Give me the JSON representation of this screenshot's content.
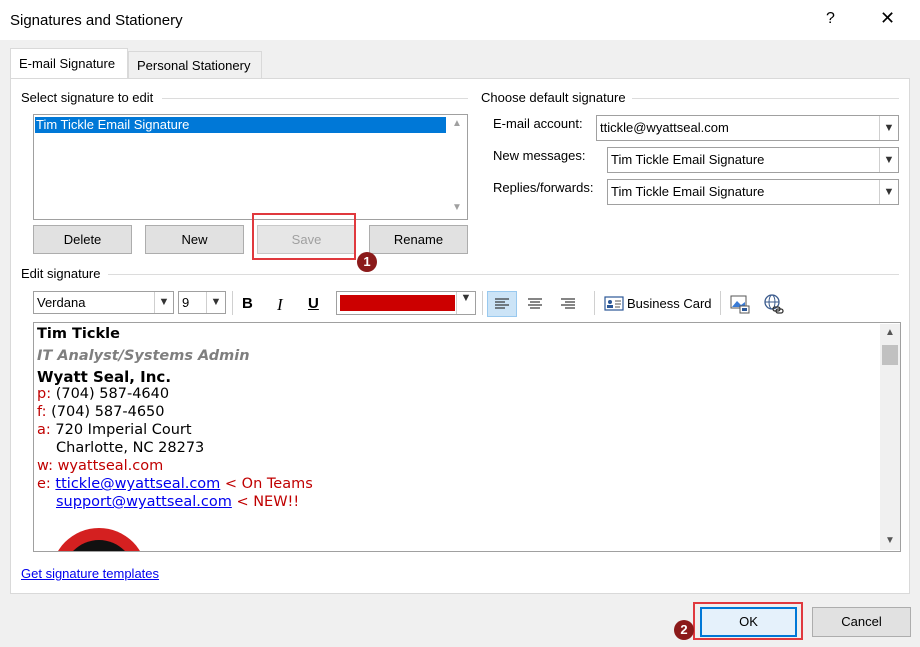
{
  "window": {
    "title": "Signatures and Stationery",
    "help_label": "?",
    "close_label": "✕"
  },
  "tabs": [
    {
      "label": "E-mail Signature",
      "active": true
    },
    {
      "label": "Personal Stationery",
      "active": false
    }
  ],
  "select_section": {
    "label": "Select signature to edit",
    "items": [
      "Tim Tickle Email Signature"
    ],
    "selected_index": 0
  },
  "buttons": {
    "delete": "Delete",
    "new": "New",
    "save": "Save",
    "rename": "Rename",
    "ok": "OK",
    "cancel": "Cancel"
  },
  "badges": {
    "one": "1",
    "two": "2"
  },
  "default_section": {
    "label": "Choose default signature",
    "account_label": "E-mail account:",
    "account_value": "ttickle@wyattseal.com",
    "new_messages_label": "New messages:",
    "new_messages_value": "Tim Tickle Email Signature",
    "replies_label": "Replies/forwards:",
    "replies_value": "Tim Tickle Email Signature"
  },
  "edit_section": {
    "label": "Edit signature",
    "font": "Verdana",
    "size": "9",
    "bold": "B",
    "italic": "I",
    "underline": "U",
    "font_color": "#cc0000",
    "business_card": "Business Card"
  },
  "signature": {
    "name": "Tim Tickle",
    "role": "IT Analyst/Systems Admin",
    "company": "Wyatt Seal, Inc.",
    "phone_prefix": "p:",
    "phone": "(704) 587-4640",
    "fax_prefix": "f:",
    "fax": "(704) 587-4650",
    "address_prefix": "a:",
    "address1": "720 Imperial Court",
    "address2": "Charlotte, NC 28273",
    "web_prefix": "w:",
    "web": "wyattseal.com",
    "email_prefix": "e:",
    "email1": "ttickle@wyattseal.com",
    "email1_note": "< On Teams",
    "email2": "support@wyattseal.com",
    "email2_note": "< NEW!!"
  },
  "templates_link": "Get signature templates",
  "colors": {
    "accent_red": "#c00000",
    "selection_blue": "#0078d7",
    "highlight_red": "#e0393e",
    "badge": "#8b1a1a"
  }
}
